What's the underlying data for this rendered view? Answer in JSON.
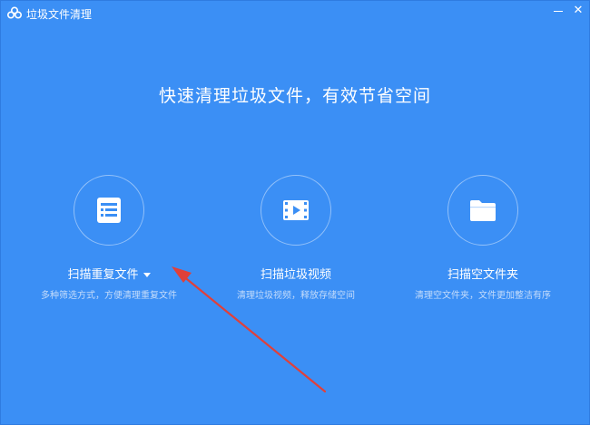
{
  "window": {
    "title": "垃圾文件清理",
    "minimize_symbol": "—",
    "close_symbol": "✕"
  },
  "headline": "快速清理垃圾文件，有效节省空间",
  "features": [
    {
      "title": "扫描重复文件",
      "description": "多种筛选方式，方便清理重复文件",
      "icon": "list-document-icon",
      "has_dropdown": true
    },
    {
      "title": "扫描垃圾视频",
      "description": "清理垃圾视频，释放存储空间",
      "icon": "video-film-icon",
      "has_dropdown": false
    },
    {
      "title": "扫描空文件夹",
      "description": "清理空文件夹，文件更加整洁有序",
      "icon": "folder-icon",
      "has_dropdown": false
    }
  ],
  "colors": {
    "background": "#3b8ff5",
    "text": "#ffffff",
    "description": "#c4dcfb",
    "annotation_arrow": "#e0403a"
  }
}
